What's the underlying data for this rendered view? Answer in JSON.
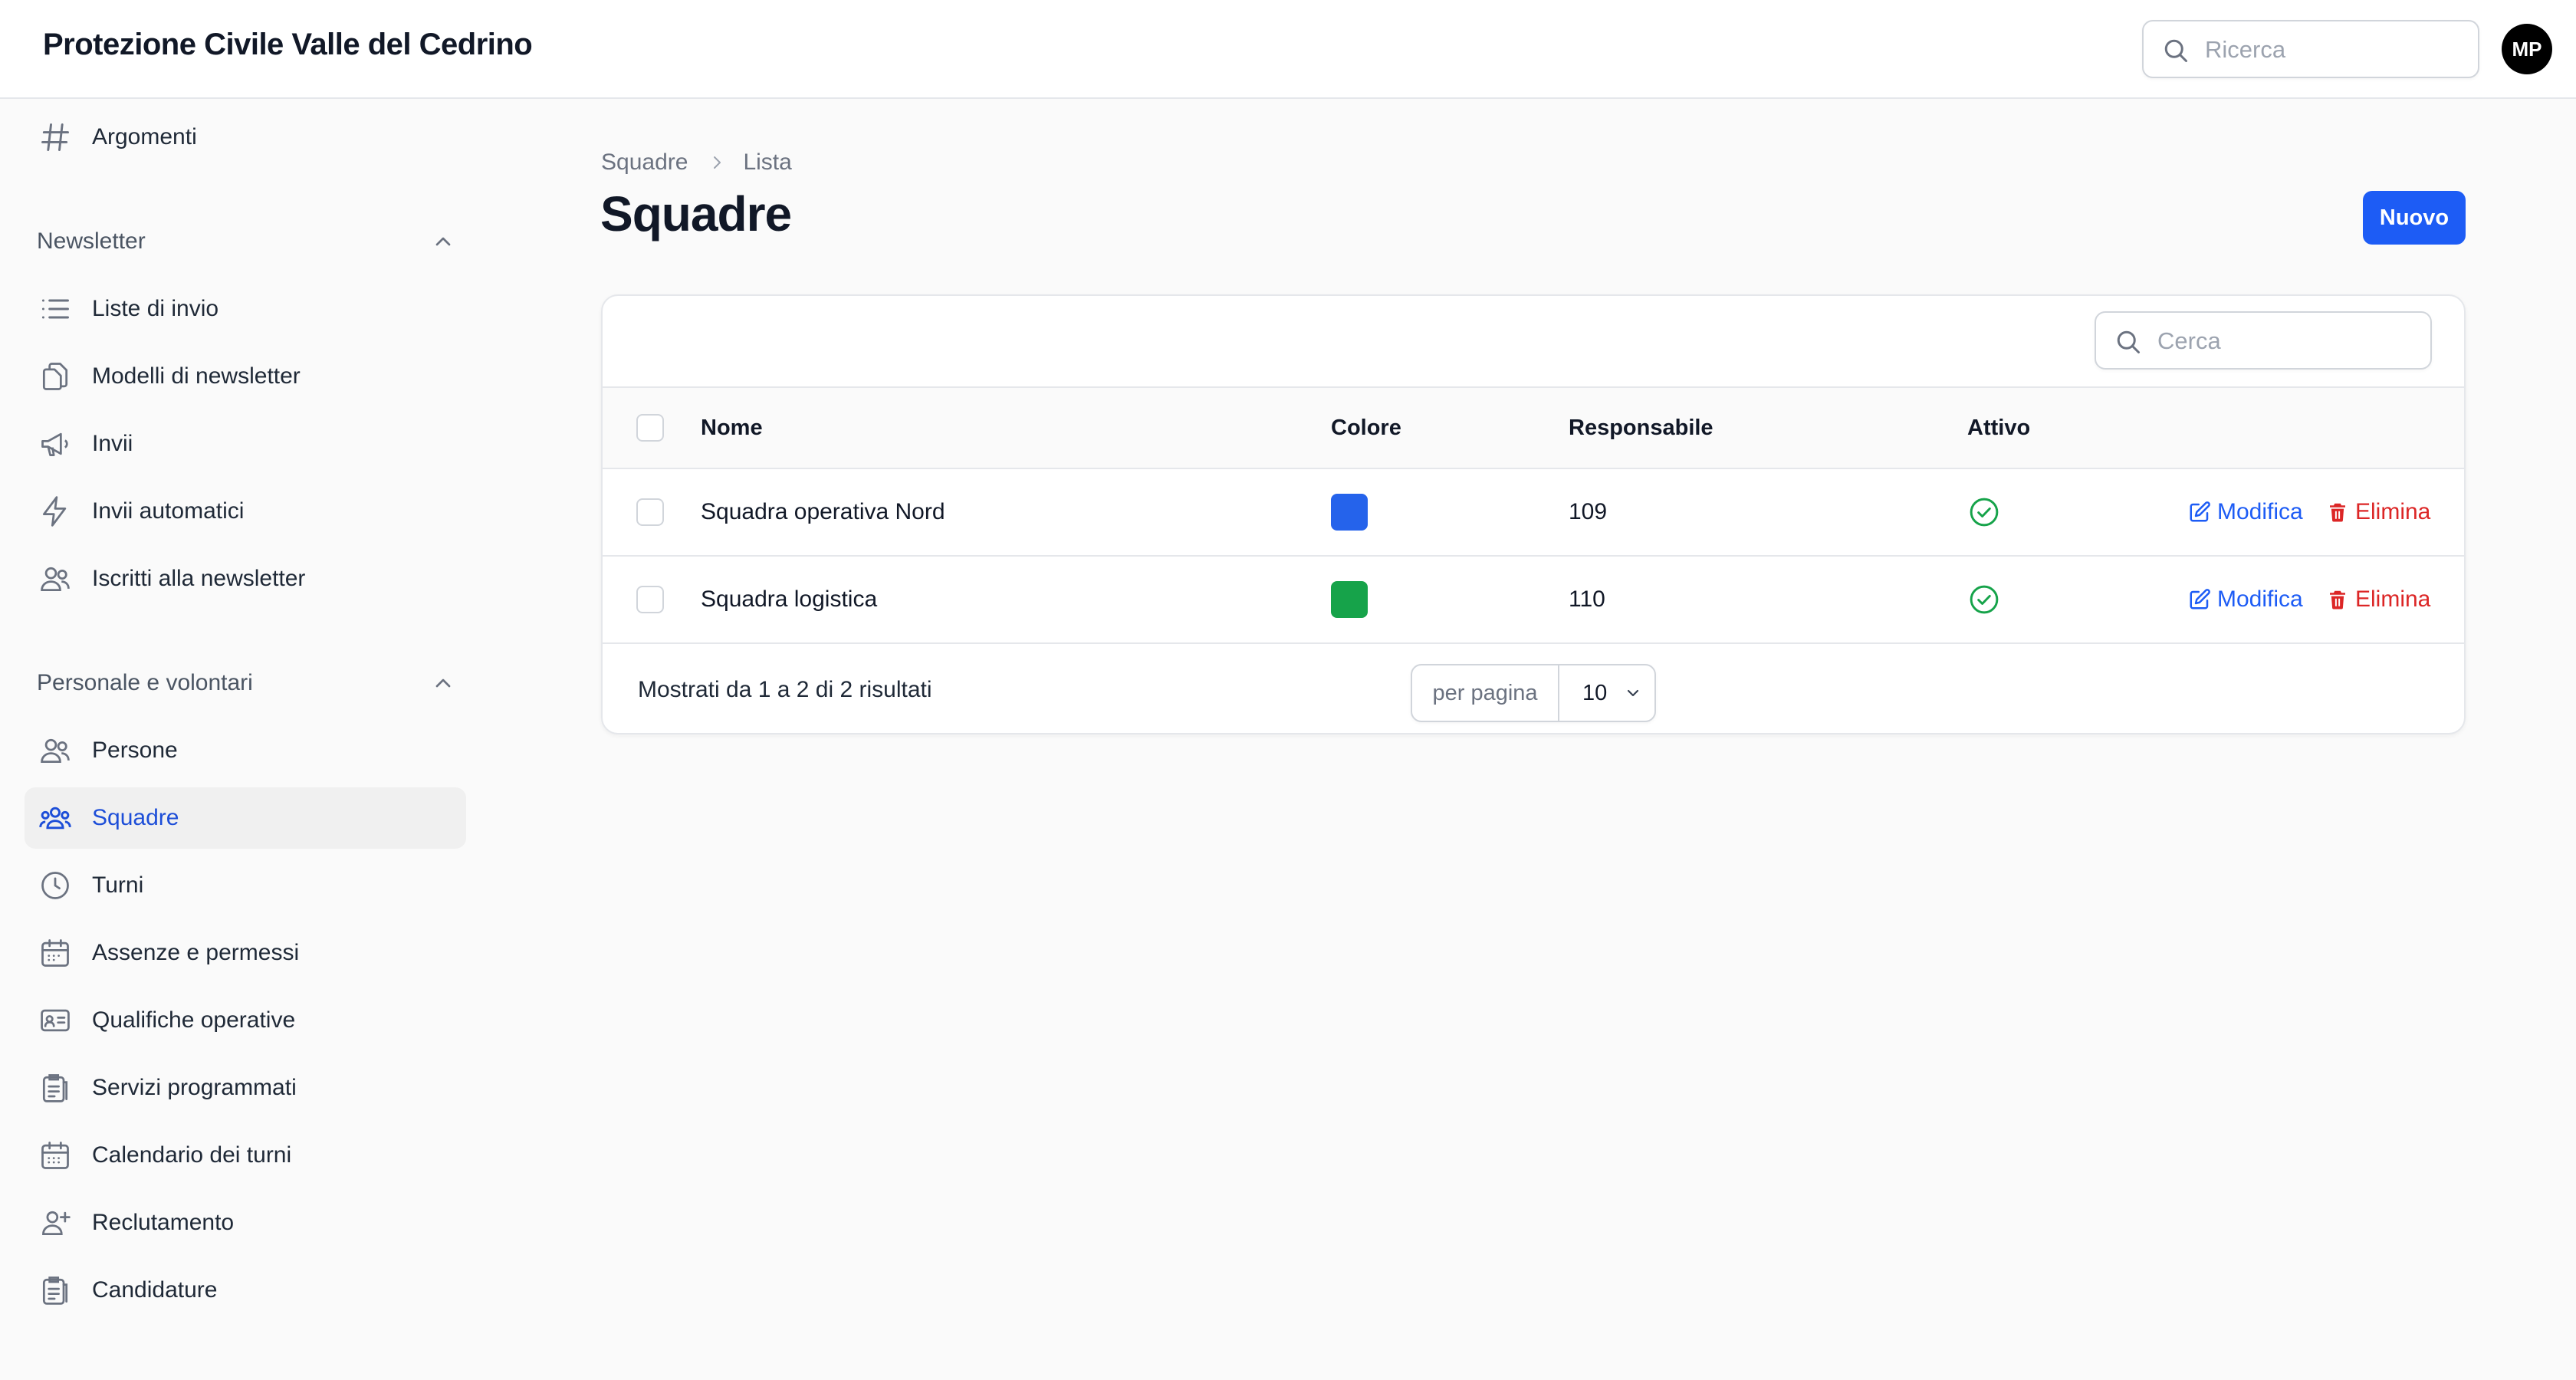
{
  "header": {
    "title": "Protezione Civile Valle del Cedrino",
    "search_placeholder": "Ricerca",
    "avatar_initials": "MP"
  },
  "sidebar": {
    "top_item": {
      "label": "Argomenti",
      "icon": "hashtag-icon"
    },
    "groups": [
      {
        "label": "Newsletter",
        "items": [
          {
            "label": "Liste di invio",
            "icon": "list-icon"
          },
          {
            "label": "Modelli di newsletter",
            "icon": "documents-icon"
          },
          {
            "label": "Invii",
            "icon": "megaphone-icon"
          },
          {
            "label": "Invii automatici",
            "icon": "bolt-icon"
          },
          {
            "label": "Iscritti alla newsletter",
            "icon": "users-icon"
          }
        ]
      },
      {
        "label": "Personale e volontari",
        "items": [
          {
            "label": "Persone",
            "icon": "users-icon"
          },
          {
            "label": "Squadre",
            "icon": "user-group-icon",
            "active": true
          },
          {
            "label": "Turni",
            "icon": "clock-icon"
          },
          {
            "label": "Assenze e permessi",
            "icon": "calendar-icon"
          },
          {
            "label": "Qualifiche operative",
            "icon": "id-card-icon"
          },
          {
            "label": "Servizi programmati",
            "icon": "clipboard-icon"
          },
          {
            "label": "Calendario dei turni",
            "icon": "calendar-days-icon"
          },
          {
            "label": "Reclutamento",
            "icon": "user-plus-icon"
          },
          {
            "label": "Candidature",
            "icon": "clipboard-list-icon"
          }
        ]
      }
    ]
  },
  "main": {
    "breadcrumb": [
      "Squadre",
      "Lista"
    ],
    "title": "Squadre",
    "new_button": "Nuovo",
    "search_placeholder": "Cerca",
    "columns": [
      "Nome",
      "Colore",
      "Responsabile",
      "Attivo"
    ],
    "rows": [
      {
        "name": "Squadra operativa Nord",
        "color": "#2563eb",
        "responsabile": "109",
        "active": true
      },
      {
        "name": "Squadra logistica",
        "color": "#16a34a",
        "responsabile": "110",
        "active": true
      }
    ],
    "actions": {
      "edit": "Modifica",
      "delete": "Elimina"
    },
    "summary": "Mostrati da 1 a 2 di 2 risultati",
    "per_page_label": "per pagina",
    "per_page_value": "10"
  },
  "colors": {
    "accent": "#1d5cf5",
    "danger": "#dc2626",
    "success": "#16a34a"
  }
}
